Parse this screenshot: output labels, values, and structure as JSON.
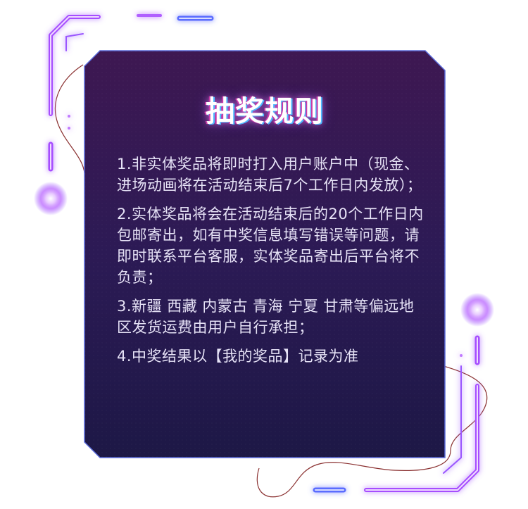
{
  "title": "抽奖规则",
  "rules": [
    "1.非实体奖品将即时打入用户账户中（现金、进场动画将在活动结束后7个工作日内发放）；",
    "2.实体奖品将会在活动结束后的20个工作日内包邮寄出，如有中奖信息填写错误等问题，请即时联系平台客服，实体奖品寄出后平台将不负责；",
    "3.新疆 西藏 内蒙古 青海 宁夏 甘肃等偏远地区发货运费由用户自行承担；",
    "4.中奖结果以【我的奖品】记录为准"
  ],
  "colors": {
    "panel_top": "#3d1852",
    "panel_bottom": "#1e1648",
    "neon_purple": "#a64dff",
    "neon_blue": "#4f6bff",
    "panel_border": "#5a6bdc"
  }
}
